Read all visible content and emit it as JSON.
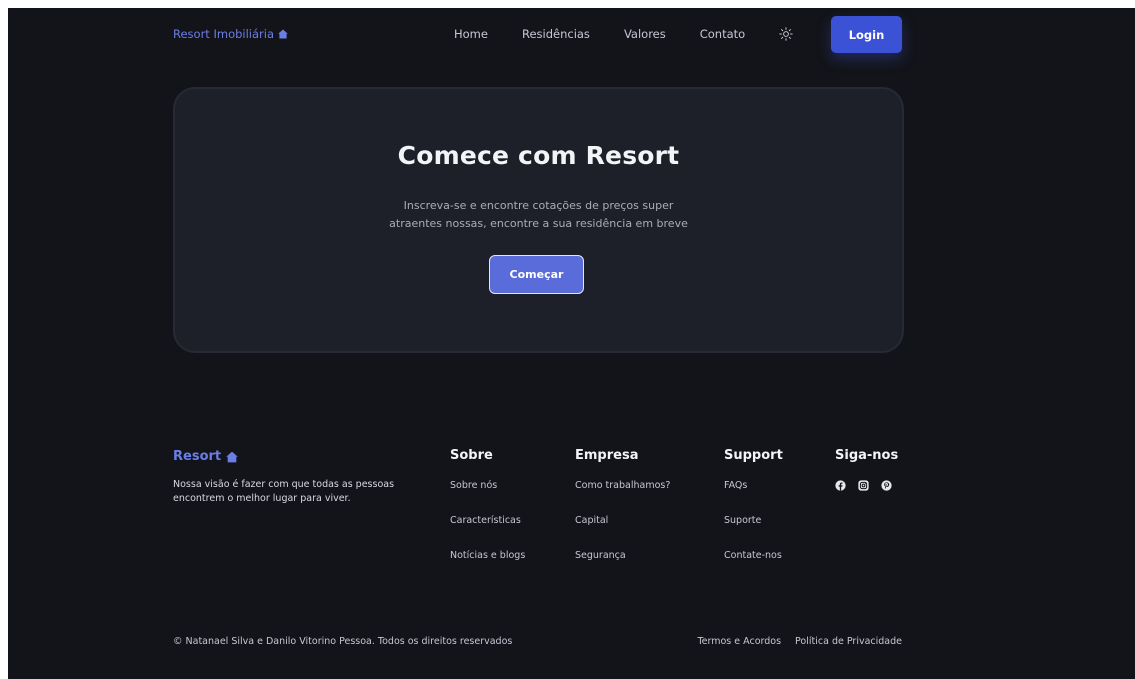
{
  "header": {
    "brand": "Resort Imobiliária",
    "nav": {
      "home": "Home",
      "residencias": "Residências",
      "valores": "Valores",
      "contato": "Contato"
    },
    "login_label": "Login"
  },
  "hero": {
    "title": "Comece com Resort",
    "subtitle_line1": "Inscreva-se e encontre cotações de preços super",
    "subtitle_line2": "atraentes nossas, encontre a sua residência em breve",
    "cta_label": "Começar"
  },
  "footer": {
    "brand": "Resort",
    "description": "Nossa visão é fazer com que todas as pessoas encontrem o melhor lugar para viver.",
    "sobre": {
      "title": "Sobre",
      "links": [
        "Sobre nós",
        "Características",
        "Notícias e blogs"
      ]
    },
    "empresa": {
      "title": "Empresa",
      "links": [
        "Como trabalhamos?",
        "Capital",
        "Segurança"
      ]
    },
    "support": {
      "title": "Support",
      "links": [
        "FAQs",
        "Suporte",
        "Contate-nos"
      ]
    },
    "social": {
      "title": "Siga-nos",
      "icons": [
        "facebook-icon",
        "instagram-icon",
        "pinterest-icon"
      ]
    },
    "copyright": "© Natanael Silva e Danilo Vitorino Pessoa. Todos os direitos reservados",
    "terms": "Termos e Acordos",
    "privacy": "Política de Privacidade"
  },
  "colors": {
    "background": "#131419",
    "card": "#1d2029",
    "accent": "#6b7ee6",
    "login_button": "#3b52d6",
    "cta_button": "#5a6cd9",
    "text_primary": "#f3f4f7",
    "text_secondary": "#c5c8d4"
  }
}
